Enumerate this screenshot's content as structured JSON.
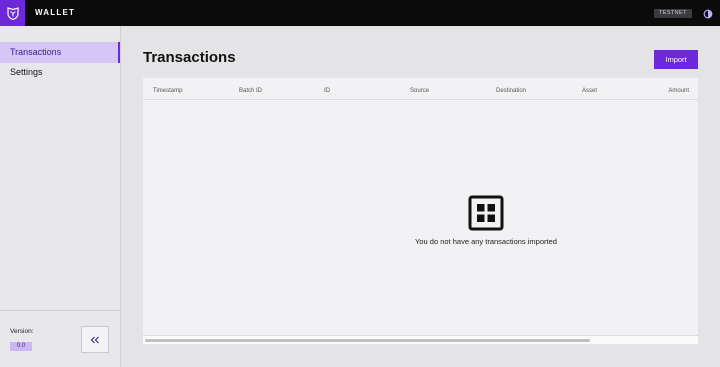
{
  "header": {
    "app_title": "WALLET",
    "network_badge": "TESTNET",
    "logo_icon": "shield-logo-icon",
    "theme_icon": "theme-toggle-icon"
  },
  "sidebar": {
    "items": [
      {
        "label": "Transactions",
        "active": true
      },
      {
        "label": "Settings",
        "active": false
      }
    ],
    "version_label": "Version:",
    "version_value": "0.0",
    "collapse_icon": "double-chevron-left-icon"
  },
  "main": {
    "title": "Transactions",
    "import_label": "Import",
    "columns": [
      "Timestamp",
      "Batch ID",
      "ID",
      "Source",
      "Destination",
      "Asset",
      "Amount"
    ],
    "rows": [],
    "empty_icon": "grid-icon",
    "empty_message": "You do not have any transactions imported"
  },
  "colors": {
    "accent": "#6d28d9",
    "topbar": "#0b0b0c",
    "active_nav_bg": "#d4c6f5"
  }
}
